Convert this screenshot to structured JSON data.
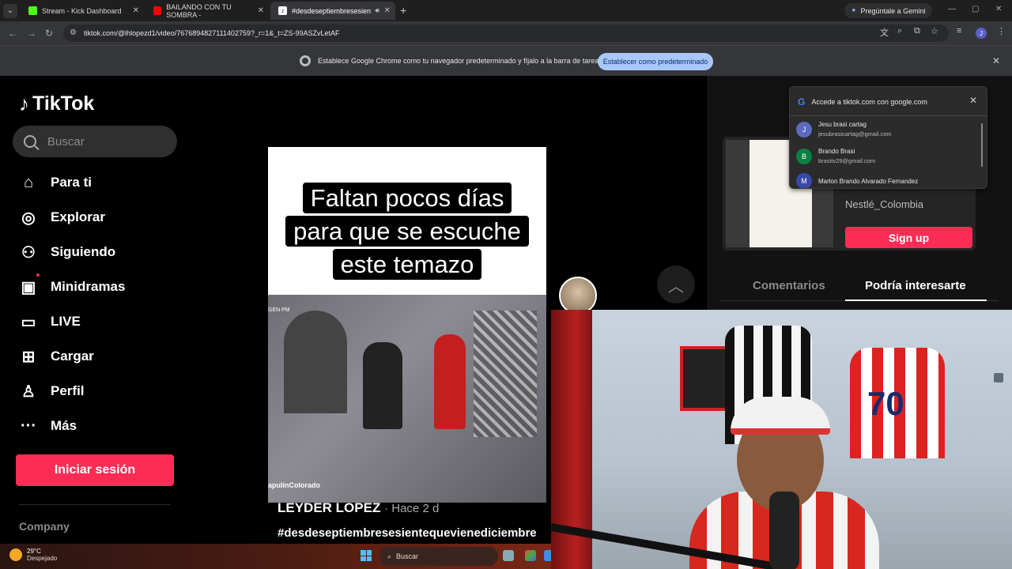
{
  "browser": {
    "tabs": [
      {
        "title": "Stream - Kick Dashboard",
        "color": "#53fc18"
      },
      {
        "title": "BAILANDO CON TU SOMBRA -",
        "color": "#ff0000"
      },
      {
        "title": "#desdeseptiembresesiente",
        "color": "#000000"
      }
    ],
    "gemini_label": "Pregúntale a Gemini",
    "url": "tiktok.com/@lhlopezd1/video/7676894827111402759?_r=1&_t=ZS-99ASZvLetAF",
    "profile_initial": "J",
    "infobar_message": "Establece Google Chrome como tu navegador predeterminado y fíjalo a la barra de tareas",
    "infobar_button": "Establecer como predeterminado"
  },
  "sidebar": {
    "logo": "TikTok",
    "search_placeholder": "Buscar",
    "items": [
      {
        "label": "Para ti",
        "icon": "home-icon"
      },
      {
        "label": "Explorar",
        "icon": "compass-icon"
      },
      {
        "label": "Siguiendo",
        "icon": "user-follow-icon"
      },
      {
        "label": "Minidramas",
        "icon": "film-icon"
      },
      {
        "label": "LIVE",
        "icon": "live-tv-icon"
      },
      {
        "label": "Cargar",
        "icon": "upload-plus-icon"
      },
      {
        "label": "Perfil",
        "icon": "profile-icon"
      },
      {
        "label": "Más",
        "icon": "more-dots-icon"
      }
    ],
    "login_button": "Iniciar sesión",
    "company": "Company"
  },
  "video": {
    "caption_line1": "Faltan pocos días",
    "caption_line2": "para que se escuche",
    "caption_line3": "este temazo",
    "clip_tag": "apulínColorado",
    "clip_corner": "GEN PM",
    "author": "LEYDER LOPEZ",
    "time": "· Hace 2 d",
    "hashtag": "#desdeseptiembresesientequevienediciembre"
  },
  "right_panel": {
    "brand": "Nestlé_Colombia",
    "signup": "Sign up",
    "tab_comments": "Comentarios",
    "tab_related": "Podría interesarte"
  },
  "google_popup": {
    "title": "Accede a tiktok.com con google.com",
    "accounts": [
      {
        "initial": "J",
        "name": "Jesu brasi cartag",
        "email": "jesubrasicartag@gmail.com",
        "color": "#5c6bc0"
      },
      {
        "initial": "B",
        "name": "Brando Brasi",
        "email": "brasitv29@gmail.com",
        "color": "#0b8043"
      },
      {
        "initial": "M",
        "name": "Marlon Brando Alvarado Fernandez",
        "email": "",
        "color": "#3949ab"
      }
    ]
  },
  "taskbar": {
    "temperature": "29°C",
    "weather": "Despejado",
    "search": "Buscar"
  }
}
